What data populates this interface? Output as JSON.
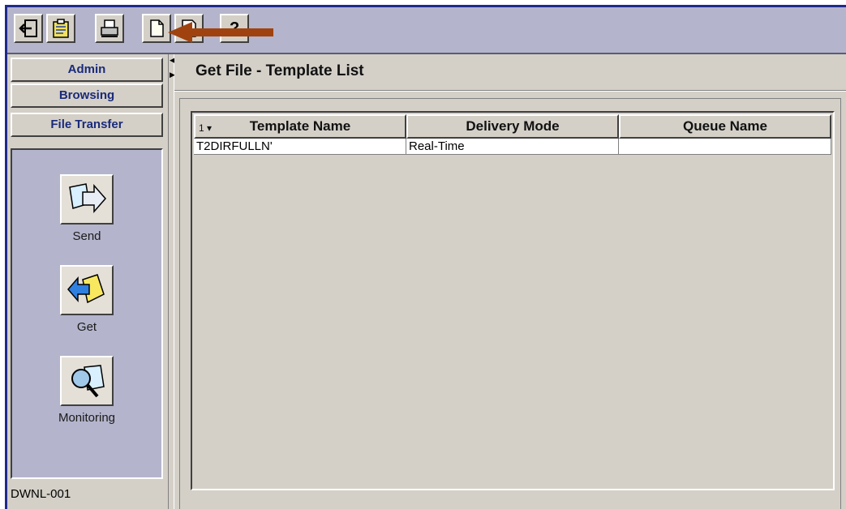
{
  "toolbar": {
    "buttons": [
      {
        "icon": "exit-icon"
      },
      {
        "icon": "clipboard-icon"
      },
      {
        "icon": "printer-icon"
      },
      {
        "icon": "new-document-icon"
      },
      {
        "icon": "save-document-icon"
      },
      {
        "icon": "help-menu-icon",
        "glyph": "?"
      }
    ],
    "annotation_color": "#a0420f"
  },
  "sidebar": {
    "nav": [
      {
        "label": "Admin"
      },
      {
        "label": "Browsing"
      },
      {
        "label": "File Transfer"
      }
    ],
    "tools": [
      {
        "label": "Send",
        "icon": "send-file-icon"
      },
      {
        "label": "Get",
        "icon": "get-file-icon"
      },
      {
        "label": "Monitoring",
        "icon": "monitoring-icon"
      }
    ],
    "status_id": "DWNL-001"
  },
  "main": {
    "title": "Get File - Template List",
    "table": {
      "sort_indicator": "1 ▾",
      "columns": [
        "Template Name",
        "Delivery Mode",
        "Queue Name"
      ],
      "rows": [
        [
          "T2DIRFULLN'",
          "Real-Time",
          ""
        ]
      ]
    }
  },
  "colors": {
    "window_border": "#1e2a8c",
    "toolbar_bg": "#b4b4cc",
    "nav_text": "#1a2a7a",
    "panel_bg": "#d4d0c8"
  }
}
